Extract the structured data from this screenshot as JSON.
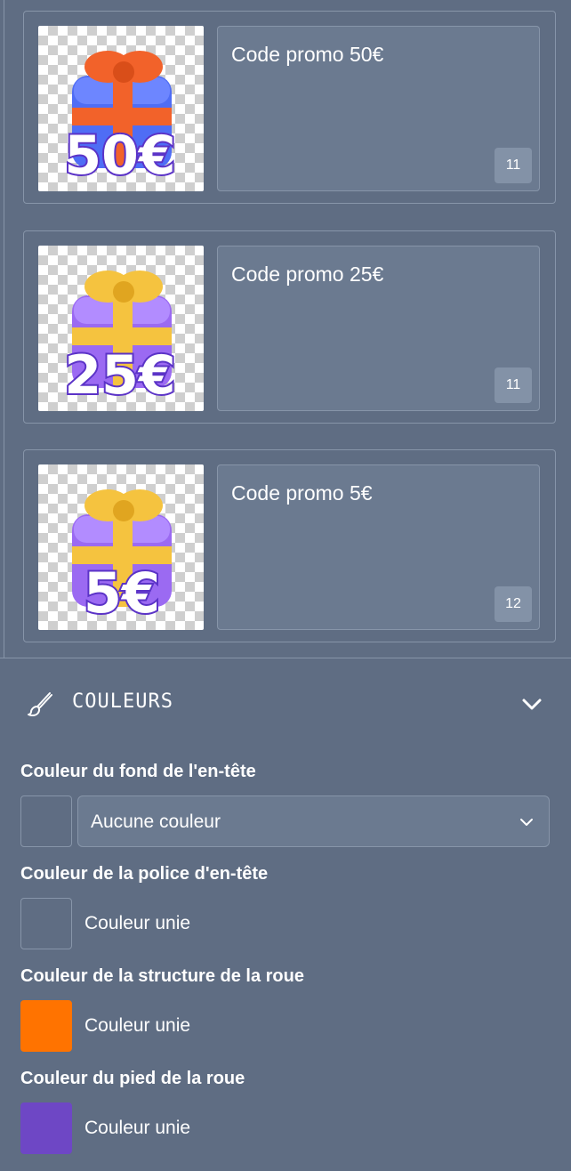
{
  "prizes": [
    {
      "label": "Code promo 50€",
      "count": "11",
      "image_text": "50€",
      "ribbon_color": "#f2622a",
      "box_color": "#4f6df5",
      "image_name": "gift-50-image"
    },
    {
      "label": "Code promo 25€",
      "count": "11",
      "image_text": "25€",
      "ribbon_color": "#f5c33f",
      "box_color": "#9b6af2",
      "image_name": "gift-25-image"
    },
    {
      "label": "Code promo 5€",
      "count": "12",
      "image_text": "5€",
      "ribbon_color": "#f5c33f",
      "box_color": "#9b6af2",
      "image_name": "gift-5-image"
    }
  ],
  "colors_section": {
    "title": "COULEURS",
    "fields": [
      {
        "label": "Couleur du fond de l'en-tête",
        "select_value": "Aucune couleur",
        "swatch_color": "transparent"
      },
      {
        "label": "Couleur de la police d'en-tête",
        "value_text": "Couleur unie",
        "swatch_color": "transparent"
      },
      {
        "label": "Couleur de la structure de la roue",
        "value_text": "Couleur unie",
        "swatch_color": "#ff7300"
      },
      {
        "label": "Couleur du pied de la roue",
        "value_text": "Couleur unie",
        "swatch_color": "#6e47c5"
      }
    ]
  },
  "theme": {
    "background": "#5f6d83",
    "input_background": "#6b7a90",
    "border": "#8795a9"
  }
}
